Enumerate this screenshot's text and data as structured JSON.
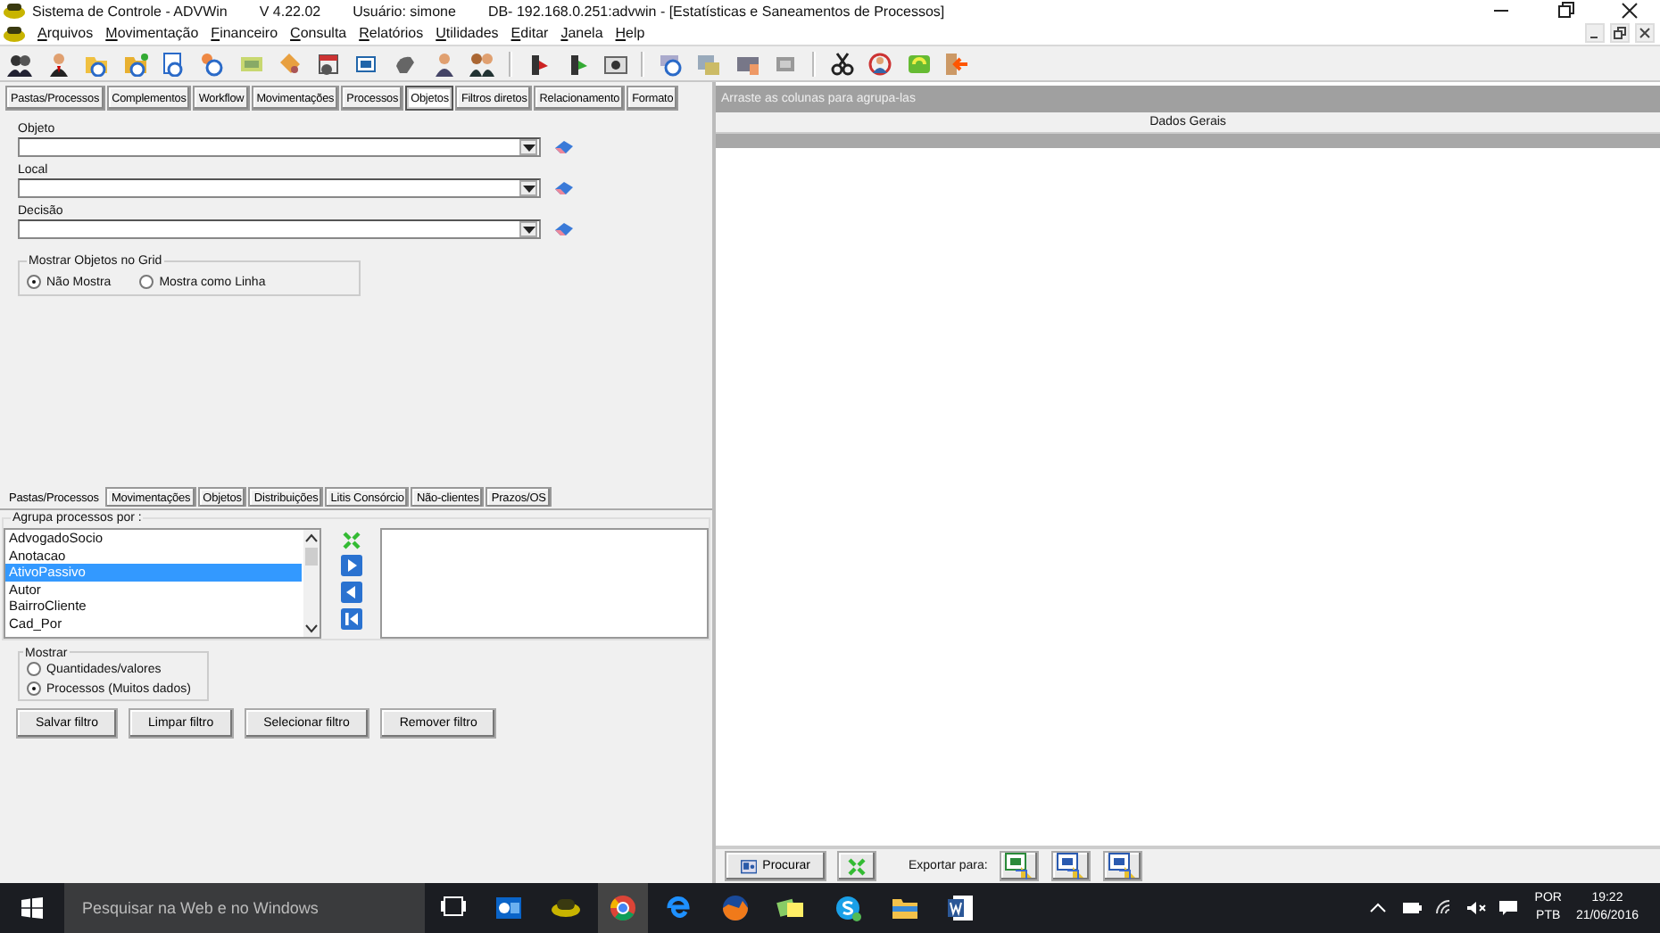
{
  "title_bar": {
    "app": "Sistema de Controle - ADVWin",
    "version": "V 4.22.02",
    "user": "Usuário: simone",
    "db": "DB- 192.168.0.251:advwin - [Estatísticas e Saneamentos de Processos]"
  },
  "menu": [
    "Arquivos",
    "Movimentação",
    "Financeiro",
    "Consulta",
    "Relatórios",
    "Utilidades",
    "Editar",
    "Janela",
    "Help"
  ],
  "top_tabs": [
    {
      "label": "Pastas/Processos",
      "selected": false
    },
    {
      "label": "Complementos",
      "selected": false
    },
    {
      "label": "Workflow",
      "selected": false
    },
    {
      "label": "Movimentações",
      "selected": false
    },
    {
      "label": "Processos",
      "selected": false
    },
    {
      "label": "Objetos",
      "selected": true
    },
    {
      "label": "Filtros diretos",
      "selected": false
    },
    {
      "label": "Relacionamento",
      "selected": false
    },
    {
      "label": "Formato",
      "selected": false
    }
  ],
  "fields": [
    {
      "label": "Objeto"
    },
    {
      "label": "Local"
    },
    {
      "label": "Decisão"
    }
  ],
  "grid_display": {
    "title": "Mostrar Objetos no Grid",
    "options": [
      {
        "label": "Não Mostra",
        "selected": true
      },
      {
        "label": "Mostra como Linha",
        "selected": false
      }
    ]
  },
  "bottom_tabs": [
    {
      "label": "Pastas/Processos",
      "selected": true
    },
    {
      "label": "Movimentações",
      "selected": false
    },
    {
      "label": "Objetos",
      "selected": false
    },
    {
      "label": "Distribuições",
      "selected": false
    },
    {
      "label": "Litis Consórcio",
      "selected": false
    },
    {
      "label": "Não-clientes",
      "selected": false
    },
    {
      "label": "Prazos/OS",
      "selected": false
    }
  ],
  "group_by": {
    "title": "Agrupa processos por :",
    "items": [
      {
        "label": "AdvogadoSocio",
        "selected": false
      },
      {
        "label": "Anotacao",
        "selected": false
      },
      {
        "label": "AtivoPassivo",
        "selected": true
      },
      {
        "label": "Autor",
        "selected": false
      },
      {
        "label": "BairroCliente",
        "selected": false
      },
      {
        "label": "Cad_Por",
        "selected": false
      }
    ]
  },
  "show": {
    "title": "Mostrar",
    "options": [
      {
        "label": "Quantidades/valores",
        "selected": false
      },
      {
        "label": "Processos (Muitos dados)",
        "selected": true
      }
    ]
  },
  "filter_buttons": [
    "Salvar filtro",
    "Limpar filtro",
    "Selecionar filtro",
    "Remover filtro"
  ],
  "grid": {
    "group_hint": "Arraste as colunas para agrupa-las",
    "band": "Dados Gerais"
  },
  "footer": {
    "search_button": "Procurar",
    "export_label": "Exportar para:"
  },
  "taskbar": {
    "search_placeholder": "Pesquisar na Web e no Windows",
    "language": "POR",
    "layout": "PTB",
    "time": "19:22",
    "date": "21/06/2016"
  }
}
